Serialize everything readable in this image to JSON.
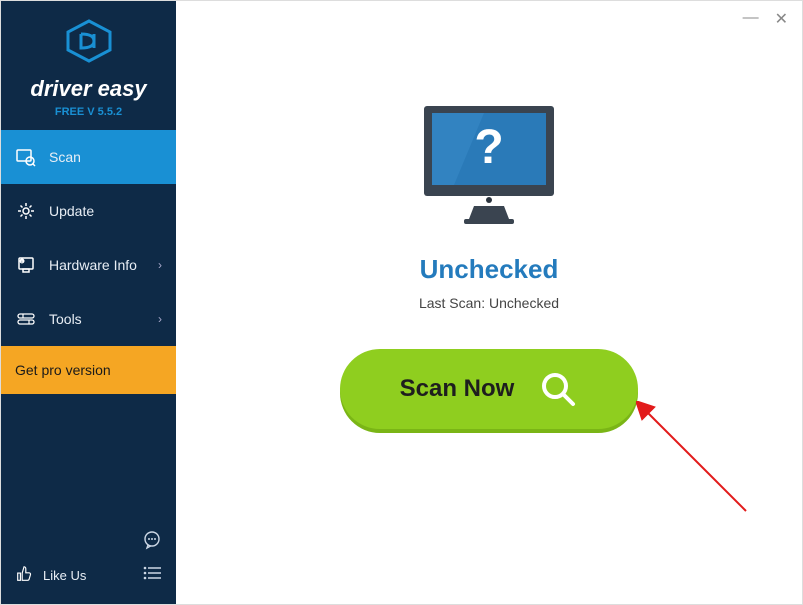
{
  "brand_name": "driver easy",
  "version_label": "FREE V 5.5.2",
  "sidebar": {
    "items": [
      {
        "label": "Scan",
        "name": "sidebar-item-scan",
        "icon": "scan-icon",
        "active": true,
        "chevron": false
      },
      {
        "label": "Update",
        "name": "sidebar-item-update",
        "icon": "gear-icon",
        "active": false,
        "chevron": false
      },
      {
        "label": "Hardware Info",
        "name": "sidebar-item-hardware",
        "icon": "hardware-icon",
        "active": false,
        "chevron": true
      },
      {
        "label": "Tools",
        "name": "sidebar-item-tools",
        "icon": "tools-icon",
        "active": false,
        "chevron": true
      }
    ],
    "pro_label": "Get pro version",
    "like_us": "Like Us"
  },
  "main": {
    "status": "Unchecked",
    "last_scan_label": "Last Scan: Unchecked",
    "scan_button": "Scan Now"
  },
  "colors": {
    "sidebar_bg": "#0e2a47",
    "accent": "#1990d4",
    "pro_bg": "#f5a623",
    "scan_btn": "#8fce1f",
    "status_text": "#247bbd"
  }
}
